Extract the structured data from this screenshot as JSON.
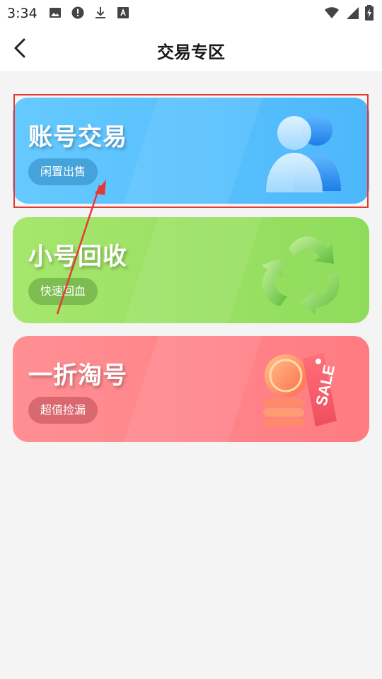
{
  "status_bar": {
    "time": "3:34"
  },
  "header": {
    "title": "交易专区"
  },
  "cards": [
    {
      "title": "账号交易",
      "button": "闲置出售",
      "icon": "users-icon",
      "color": "#55bdfc"
    },
    {
      "title": "小号回收",
      "button": "快速回血",
      "icon": "recycle-icon",
      "color": "#99e062"
    },
    {
      "title": "一折淘号",
      "button": "超值捡漏",
      "icon": "sale-tag-icon",
      "color": "#ff858b",
      "art_text": "SALE"
    }
  ]
}
